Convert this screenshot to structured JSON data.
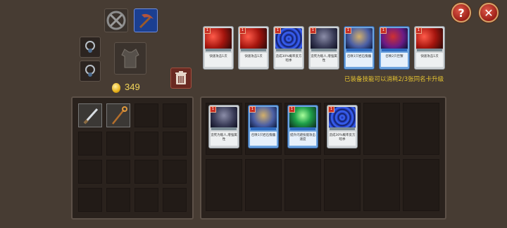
{
  "header": {
    "help_label": "?",
    "close_label": "✕"
  },
  "currency": {
    "gold": "349"
  },
  "equipped_hint": "已装备技能可以消耗2/3张同名卡升级",
  "equipped_cards": [
    {
      "level": "1",
      "text": "快速攻击1次",
      "icon": "red-slash",
      "rarity": "common"
    },
    {
      "level": "1",
      "text": "快速攻击1次",
      "icon": "red-slash",
      "rarity": "common"
    },
    {
      "level": "1",
      "text": "造成30%概率反方暗季",
      "icon": "blue-swirl",
      "rarity": "common"
    },
    {
      "level": "1",
      "text": "造死为敌人,增强属性",
      "icon": "monster",
      "rarity": "common"
    },
    {
      "level": "1",
      "text": "召唤1只岩石傀儡",
      "icon": "golem",
      "rarity": "rare"
    },
    {
      "level": "1",
      "text": "召唤2只巨蟹",
      "icon": "crab",
      "rarity": "rare"
    },
    {
      "level": "1",
      "text": "快速攻击1次",
      "icon": "red-slash",
      "rarity": "common"
    }
  ],
  "inventory_cards": [
    {
      "level": "1",
      "text": "造死为敌人,增强属性",
      "icon": "monster",
      "rarity": "common"
    },
    {
      "level": "1",
      "text": "召唤1只岩石傀儡",
      "icon": "golem",
      "rarity": "rare"
    },
    {
      "level": "1",
      "text": "提升闪避技能攻击速度",
      "icon": "green-energy",
      "rarity": "rare"
    },
    {
      "level": "1",
      "text": "造成30%概率反方暗季",
      "icon": "blue-swirl",
      "rarity": "common"
    }
  ],
  "colors": {
    "background": "#473c33",
    "gold": "#f3d65a",
    "hint": "#e7c531",
    "button_red": "#c1342a"
  }
}
